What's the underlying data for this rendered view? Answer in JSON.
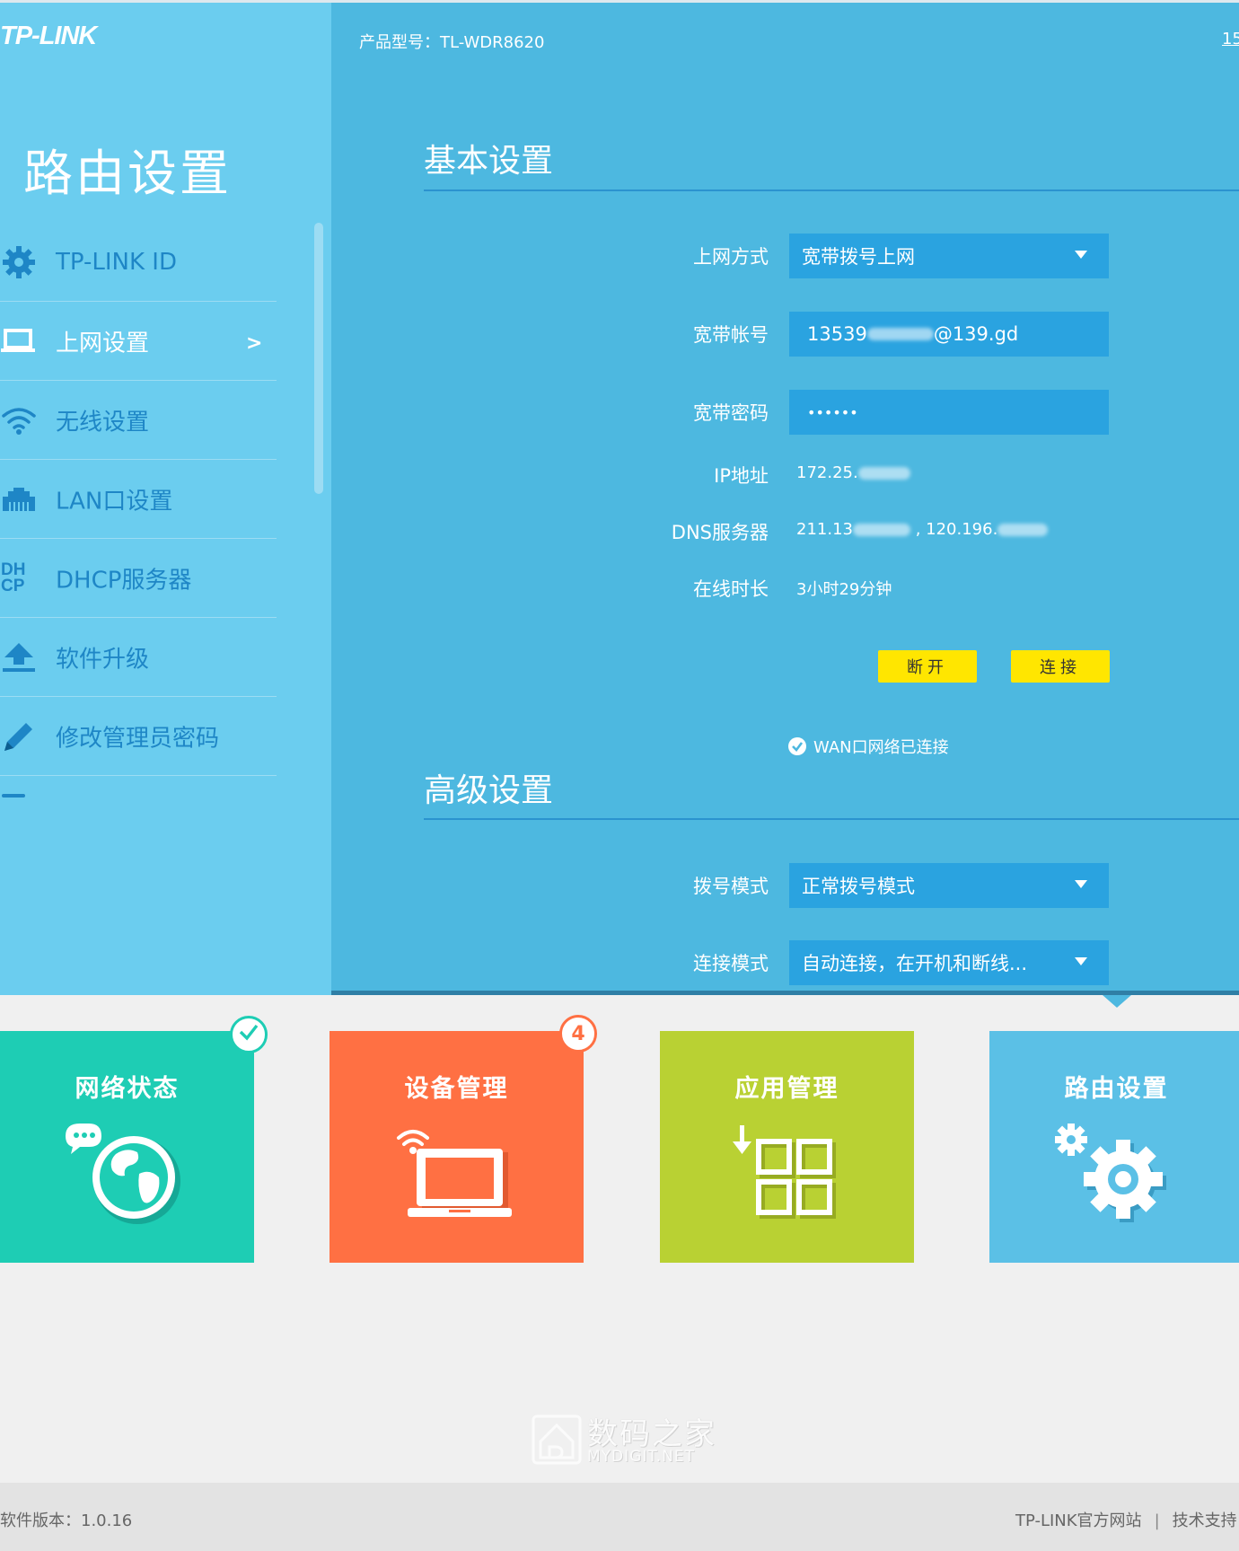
{
  "header": {
    "logo": "TP-LINK",
    "model_label": "产品型号：TL-WDR8620",
    "top_right_link": "15"
  },
  "sidebar": {
    "title": "路由设置",
    "items": [
      {
        "label": "TP-LINK ID",
        "icon": "gear-icon"
      },
      {
        "label": "上网设置",
        "icon": "laptop-icon",
        "active": true,
        "arrow": ">"
      },
      {
        "label": "无线设置",
        "icon": "wifi-icon"
      },
      {
        "label": "LAN口设置",
        "icon": "lan-port-icon"
      },
      {
        "label": "DHCP服务器",
        "icon": "dhcp-icon",
        "icon_text": "DH CP"
      },
      {
        "label": "软件升级",
        "icon": "upload-icon"
      },
      {
        "label": "修改管理员密码",
        "icon": "pencil-icon"
      }
    ]
  },
  "basic": {
    "title": "基本设置",
    "connection_type": {
      "label": "上网方式",
      "value": "宽带拨号上网"
    },
    "account": {
      "label": "宽带帐号",
      "value_prefix": "13539",
      "value_suffix": "@139.gd"
    },
    "password": {
      "label": "宽带密码",
      "value": "••••••"
    },
    "ip": {
      "label": "IP地址",
      "value_prefix": "172.25."
    },
    "dns": {
      "label": "DNS服务器",
      "value_prefix": "211.13",
      "value_mid": " , 120.196."
    },
    "uptime": {
      "label": "在线时长",
      "value": "3小时29分钟"
    },
    "disconnect_button": "断开",
    "connect_button": "连接",
    "status": "WAN口网络已连接"
  },
  "advanced": {
    "title": "高级设置",
    "dial_mode": {
      "label": "拨号模式",
      "value": "正常拨号模式"
    },
    "connect_mode": {
      "label": "连接模式",
      "value": "自动连接，在开机和断线..."
    }
  },
  "tiles": [
    {
      "label": "网络状态",
      "color": "#1ecdb4",
      "icon": "globe-chat-icon",
      "badge_icon": "check-icon"
    },
    {
      "label": "设备管理",
      "color": "#ff7043",
      "icon": "laptop-wifi-icon",
      "badge": "4"
    },
    {
      "label": "应用管理",
      "color": "#b9d133",
      "icon": "apps-grid-icon"
    },
    {
      "label": "路由设置",
      "color": "#5bc0e6",
      "icon": "settings-gears-icon"
    }
  ],
  "watermark": {
    "cn": "数码之家",
    "en": "MYDIGIT.NET"
  },
  "footer": {
    "version": "软件版本：1.0.16",
    "official_site": "TP-LINK官方网站",
    "separator": "|",
    "support": "技术支持"
  },
  "colors": {
    "sidebar_bg": "#6bcdef",
    "main_bg": "#4db8e0",
    "field_bg": "#2aa3e0",
    "button_yellow": "#ffe600"
  }
}
